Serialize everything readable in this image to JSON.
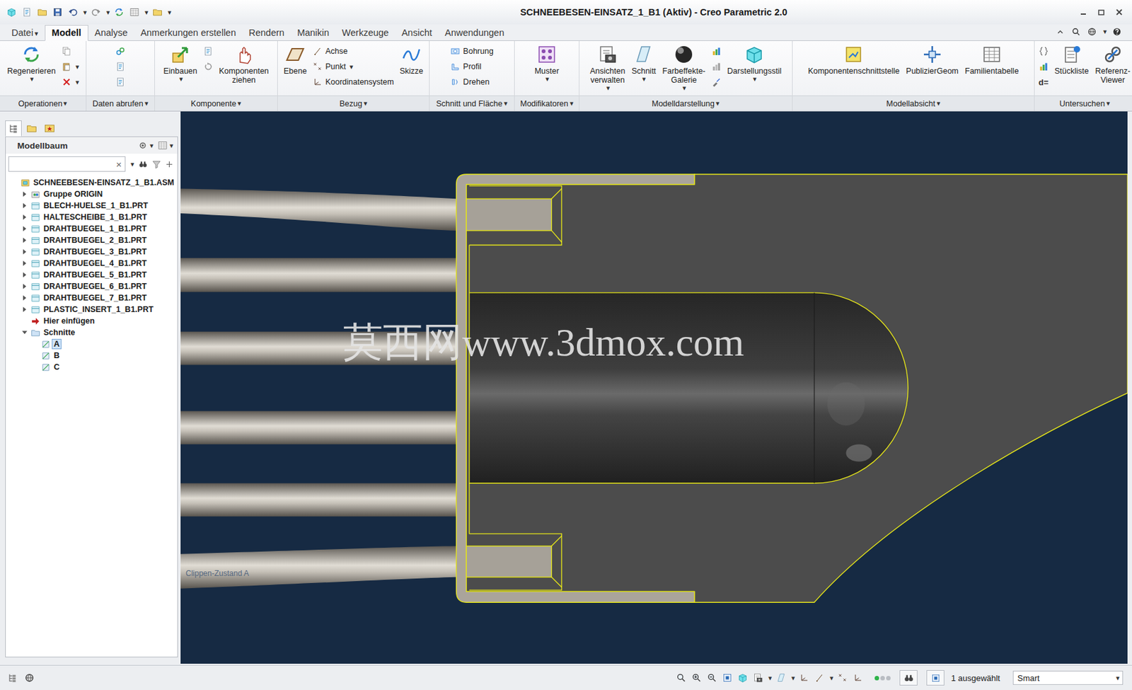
{
  "window": {
    "title": "SCHNEEBESEN-EINSATZ_1_B1 (Aktiv) - Creo Parametric 2.0"
  },
  "glyphs": {
    "dropdown": "▾",
    "clear": "×"
  },
  "quick_access": [
    {
      "dropdown": false
    },
    {
      "dropdown": false
    },
    {
      "dropdown": false
    },
    {
      "dropdown": false
    },
    {
      "dropdown": true
    },
    {
      "dropdown": true
    },
    {
      "dropdown": false
    },
    {
      "dropdown": true
    },
    {
      "dropdown": true
    }
  ],
  "menu_tabs": [
    {
      "label": "Datei",
      "selected": false,
      "dropdown": true
    },
    {
      "label": "Modell",
      "selected": true,
      "dropdown": false
    },
    {
      "label": "Analyse",
      "selected": false,
      "dropdown": false
    },
    {
      "label": "Anmerkungen erstellen",
      "selected": false,
      "dropdown": false
    },
    {
      "label": "Rendern",
      "selected": false,
      "dropdown": false
    },
    {
      "label": "Manikin",
      "selected": false,
      "dropdown": false
    },
    {
      "label": "Werkzeuge",
      "selected": false,
      "dropdown": false
    },
    {
      "label": "Ansicht",
      "selected": false,
      "dropdown": false
    },
    {
      "label": "Anwendungen",
      "selected": false,
      "dropdown": false
    }
  ],
  "ribbon_groups": [
    {
      "label": "Operationen",
      "dropdown": true,
      "columns": [
        [
          {
            "label": "Regenerieren",
            "kind": "large",
            "dropdown": true
          }
        ],
        [
          {
            "kind": "icon",
            "dropdown": false
          },
          {
            "kind": "icon",
            "dropdown": true
          },
          {
            "kind": "icon",
            "dropdown": true
          }
        ]
      ]
    },
    {
      "label": "Daten abrufen",
      "dropdown": true,
      "columns": [
        [
          {
            "kind": "icon",
            "dropdown": false
          },
          {
            "kind": "icon",
            "dropdown": false
          },
          {
            "kind": "icon",
            "dropdown": false
          }
        ]
      ]
    },
    {
      "label": "Komponente",
      "dropdown": true,
      "columns": [
        [
          {
            "label": "Einbauen",
            "kind": "large",
            "dropdown": true
          }
        ],
        [
          {
            "kind": "icon",
            "dropdown": false
          },
          {
            "kind": "icon",
            "dropdown": false
          }
        ],
        [
          {
            "label": "Komponenten ziehen",
            "kind": "large",
            "dropdown": false
          }
        ]
      ]
    },
    {
      "label": "Bezug",
      "dropdown": true,
      "columns": [
        [
          {
            "label": "Ebene",
            "kind": "large",
            "dropdown": false
          }
        ],
        [
          {
            "label": "Achse",
            "kind": "small",
            "dropdown": false
          },
          {
            "label": "Punkt",
            "kind": "small",
            "dropdown": true
          },
          {
            "label": "Koordinatensystem",
            "kind": "small",
            "dropdown": false
          }
        ],
        [
          {
            "label": "Skizze",
            "kind": "large",
            "dropdown": false
          }
        ]
      ]
    },
    {
      "label": "Schnitt und Fläche",
      "dropdown": true,
      "columns": [
        [
          {
            "label": "Bohrung",
            "kind": "small",
            "dropdown": false
          },
          {
            "label": "Profil",
            "kind": "small",
            "dropdown": false
          },
          {
            "label": "Drehen",
            "kind": "small",
            "dropdown": false
          }
        ]
      ]
    },
    {
      "label": "Modifikatoren",
      "dropdown": true,
      "columns": [
        [
          {
            "label": "Muster",
            "kind": "large",
            "dropdown": true
          }
        ]
      ]
    },
    {
      "label": "Modelldarstellung",
      "dropdown": true,
      "columns": [
        [
          {
            "label": "Ansichten verwalten",
            "kind": "large",
            "dropdown": true
          }
        ],
        [
          {
            "label": "Schnitt",
            "kind": "large",
            "dropdown": true
          }
        ],
        [
          {
            "label": "Farbeffekte-Galerie",
            "kind": "large",
            "dropdown": true
          }
        ],
        [
          {
            "kind": "icon",
            "dropdown": false
          },
          {
            "kind": "icon",
            "dropdown": false
          },
          {
            "kind": "icon",
            "dropdown": false
          }
        ],
        [
          {
            "label": "Darstellungsstil",
            "kind": "large",
            "dropdown": true
          }
        ]
      ]
    },
    {
      "label": "Modellabsicht",
      "dropdown": true,
      "columns": [
        [
          {
            "label": "Komponentenschnittstelle",
            "kind": "large",
            "dropdown": false
          }
        ],
        [
          {
            "label": "PublizierGeom",
            "kind": "large",
            "dropdown": false
          }
        ],
        [
          {
            "label": "Familientabelle",
            "kind": "large",
            "dropdown": false
          }
        ]
      ]
    },
    {
      "label": "Untersuchen",
      "dropdown": true,
      "columns": [
        [
          {
            "kind": "icon",
            "dropdown": false
          },
          {
            "kind": "icon",
            "dropdown": false
          },
          {
            "label": "d=",
            "kind": "text",
            "dropdown": false
          }
        ],
        [
          {
            "label": "Stückliste",
            "kind": "large",
            "dropdown": false
          }
        ],
        [
          {
            "label": "Referenz-Viewer",
            "kind": "large",
            "dropdown": false
          }
        ]
      ]
    }
  ],
  "navigator": {
    "tabs": [
      {
        "selected": true
      },
      {
        "selected": false
      },
      {
        "selected": false
      }
    ]
  },
  "model_tree": {
    "title": "Modellbaum",
    "search": {
      "value": ""
    },
    "items": [
      {
        "label": "SCHNEEBESEN-EINSATZ_1_B1.ASM",
        "kind": "assembly",
        "depth": 0,
        "expandable": false,
        "expanded": true,
        "selected": false
      },
      {
        "label": "Gruppe ORIGIN",
        "kind": "group",
        "depth": 1,
        "expandable": true,
        "expanded": false,
        "selected": false
      },
      {
        "label": "BLECH-HUELSE_1_B1.PRT",
        "kind": "part",
        "depth": 1,
        "expandable": true,
        "expanded": false,
        "selected": false
      },
      {
        "label": "HALTESCHEIBE_1_B1.PRT",
        "kind": "part",
        "depth": 1,
        "expandable": true,
        "expanded": false,
        "selected": false
      },
      {
        "label": "DRAHTBUEGEL_1_B1.PRT",
        "kind": "part",
        "depth": 1,
        "expandable": true,
        "expanded": false,
        "selected": false
      },
      {
        "label": "DRAHTBUEGEL_2_B1.PRT",
        "kind": "part",
        "depth": 1,
        "expandable": true,
        "expanded": false,
        "selected": false
      },
      {
        "label": "DRAHTBUEGEL_3_B1.PRT",
        "kind": "part",
        "depth": 1,
        "expandable": true,
        "expanded": false,
        "selected": false
      },
      {
        "label": "DRAHTBUEGEL_4_B1.PRT",
        "kind": "part",
        "depth": 1,
        "expandable": true,
        "expanded": false,
        "selected": false
      },
      {
        "label": "DRAHTBUEGEL_5_B1.PRT",
        "kind": "part",
        "depth": 1,
        "expandable": true,
        "expanded": false,
        "selected": false
      },
      {
        "label": "DRAHTBUEGEL_6_B1.PRT",
        "kind": "part",
        "depth": 1,
        "expandable": true,
        "expanded": false,
        "selected": false
      },
      {
        "label": "DRAHTBUEGEL_7_B1.PRT",
        "kind": "part",
        "depth": 1,
        "expandable": true,
        "expanded": false,
        "selected": false
      },
      {
        "label": "PLASTIC_INSERT_1_B1.PRT",
        "kind": "part",
        "depth": 1,
        "expandable": true,
        "expanded": false,
        "selected": false
      },
      {
        "label": "Hier einfügen",
        "kind": "insert",
        "depth": 1,
        "expandable": false,
        "expanded": false,
        "selected": false
      },
      {
        "label": "Schnitte",
        "kind": "folder",
        "depth": 1,
        "expandable": true,
        "expanded": true,
        "selected": false
      },
      {
        "label": "A",
        "kind": "section",
        "depth": 2,
        "expandable": false,
        "expanded": false,
        "selected": true
      },
      {
        "label": "B",
        "kind": "section",
        "depth": 2,
        "expandable": false,
        "expanded": false,
        "selected": false
      },
      {
        "label": "C",
        "kind": "section",
        "depth": 2,
        "expandable": false,
        "expanded": false,
        "selected": false
      }
    ]
  },
  "viewport": {
    "watermark": "莫西网www.3dmox.com",
    "clip_state": "Clippen-Zustand A"
  },
  "status_bar": {
    "view_tools": [
      {
        "dropdown": false
      },
      {
        "dropdown": false
      },
      {
        "dropdown": false
      },
      {
        "dropdown": false
      },
      {
        "dropdown": false
      },
      {
        "dropdown": true
      },
      {
        "dropdown": true
      },
      {
        "dropdown": false
      },
      {
        "dropdown": true
      },
      {
        "dropdown": false
      },
      {
        "dropdown": false
      }
    ],
    "selection": "1 ausgewählt",
    "filter": "Smart"
  }
}
